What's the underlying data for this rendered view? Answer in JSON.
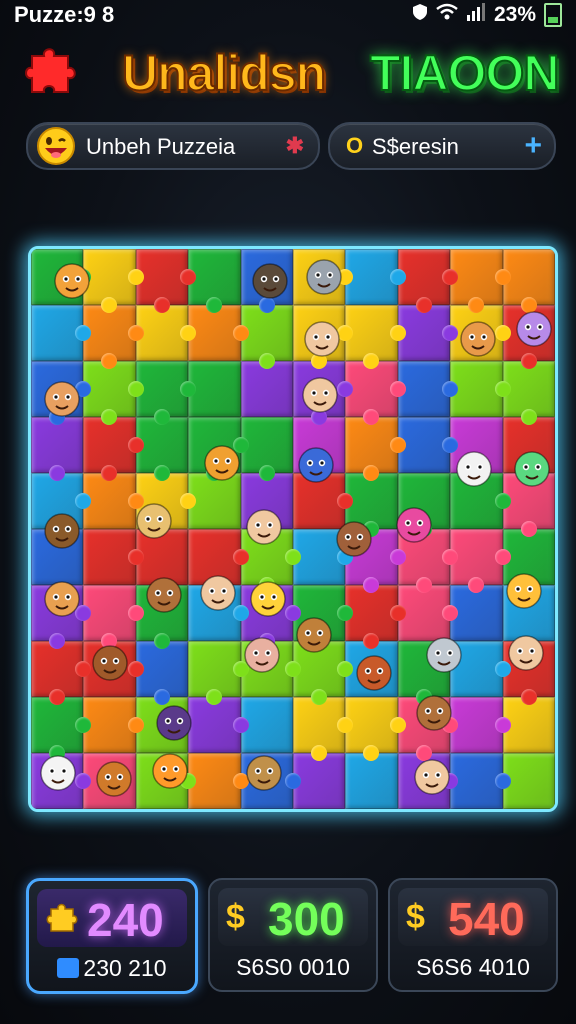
{
  "status_bar": {
    "left_text": "Puzze:9 8",
    "battery_percent": "23%",
    "icons": [
      "shield-icon",
      "wifi-icon",
      "signal-icon",
      "battery-icon"
    ]
  },
  "header": {
    "title_part1": "Unalidsn",
    "title_part2": "TIAOON",
    "logo": "puzzle-piece-icon"
  },
  "search": {
    "left_label": "Unbeh Puzzeia",
    "left_action_icon": "close-icon",
    "right_coin_glyph": "O",
    "right_label": "S$eresin",
    "right_action_icon": "plus-icon"
  },
  "board": {
    "rows": 10,
    "cols": 10,
    "border_color": "#7ee8ff"
  },
  "cards": [
    {
      "icon": "puzzle-piece-icon",
      "value": "240",
      "sub": "230 210",
      "selected": true
    },
    {
      "icon": "dollar-icon",
      "icon_glyph": "$",
      "value": "300",
      "sub": "S6S0 0010",
      "selected": false
    },
    {
      "icon": "dollar-icon",
      "icon_glyph": "$",
      "value": "540",
      "sub": "S6S6 4010",
      "selected": false
    }
  ],
  "colors": {
    "title_orange": "#ffb81c",
    "title_green": "#43ff5a",
    "accent_blue": "#4ab4ff",
    "card1_value": "#e28bff",
    "card2_value": "#74ff5a",
    "card3_value": "#ff6a5a"
  }
}
